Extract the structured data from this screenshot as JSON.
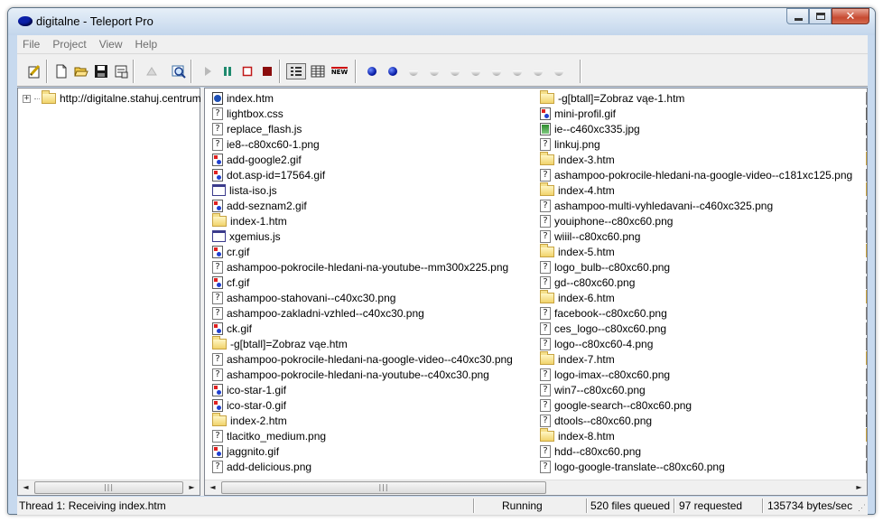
{
  "window": {
    "title": "digitalne - Teleport Pro",
    "close_glyph": "✕"
  },
  "menu": [
    "File",
    "Project",
    "View",
    "Help"
  ],
  "toolbar": {
    "buttons": [
      {
        "name": "project-properties-button",
        "icon": "pencil-note-icon"
      },
      {
        "name": "new-project-button",
        "icon": "new-page-icon"
      },
      {
        "name": "open-project-button",
        "icon": "folder-open-icon"
      },
      {
        "name": "save-project-button",
        "icon": "floppy-disk-icon"
      },
      {
        "name": "project-settings-button",
        "icon": "properties-icon"
      },
      {
        "name": "disabled-tool-button",
        "icon": "disabled-icon"
      },
      {
        "name": "browse-button",
        "icon": "magnifier-icon"
      },
      {
        "name": "start-button",
        "icon": "play-icon"
      },
      {
        "name": "pause-button",
        "icon": "pause-icon"
      },
      {
        "name": "stop-button",
        "icon": "stop-outline-icon"
      },
      {
        "name": "abort-button",
        "icon": "stop-filled-icon"
      },
      {
        "name": "list-view-button",
        "icon": "list-view-icon"
      },
      {
        "name": "details-view-button",
        "icon": "details-view-icon"
      },
      {
        "name": "new-files-button",
        "icon": "new-badge-icon"
      }
    ],
    "new_badge_text": "NEW",
    "thread_lights": [
      "active",
      "active",
      "idle",
      "idle",
      "idle",
      "idle",
      "idle",
      "idle",
      "idle",
      "idle"
    ]
  },
  "tree": {
    "root_label": "http://digitalne.stahuj.centrum",
    "expander": "+"
  },
  "files": {
    "column1": [
      {
        "name": "index.htm",
        "type": "htm"
      },
      {
        "name": "lightbox.css",
        "type": "unknown"
      },
      {
        "name": "replace_flash.js",
        "type": "unknown"
      },
      {
        "name": "ie8--c80xc60-1.png",
        "type": "unknown"
      },
      {
        "name": "add-google2.gif",
        "type": "img"
      },
      {
        "name": "dot.asp-id=17564.gif",
        "type": "img"
      },
      {
        "name": "lista-iso.js",
        "type": "js"
      },
      {
        "name": "add-seznam2.gif",
        "type": "img"
      },
      {
        "name": "index-1.htm",
        "type": "folder"
      },
      {
        "name": "xgemius.js",
        "type": "js"
      },
      {
        "name": "cr.gif",
        "type": "img"
      },
      {
        "name": "ashampoo-pokrocile-hledani-na-youtube--mm300x225.png",
        "type": "unknown"
      },
      {
        "name": "cf.gif",
        "type": "img"
      },
      {
        "name": "ashampoo-stahovani--c40xc30.png",
        "type": "unknown"
      },
      {
        "name": "ashampoo-zakladni-vzhled--c40xc30.png",
        "type": "unknown"
      },
      {
        "name": "ck.gif",
        "type": "img"
      },
      {
        "name": "-g[btall]=Zobraz vąe.htm",
        "type": "folder"
      },
      {
        "name": "ashampoo-pokrocile-hledani-na-google-video--c40xc30.png",
        "type": "unknown"
      },
      {
        "name": "ashampoo-pokrocile-hledani-na-youtube--c40xc30.png",
        "type": "unknown"
      },
      {
        "name": "ico-star-1.gif",
        "type": "img"
      },
      {
        "name": "ico-star-0.gif",
        "type": "img"
      },
      {
        "name": "index-2.htm",
        "type": "folder"
      },
      {
        "name": "tlacitko_medium.png",
        "type": "unknown"
      },
      {
        "name": "jaggnito.gif",
        "type": "img"
      },
      {
        "name": "add-delicious.png",
        "type": "unknown"
      }
    ],
    "column2": [
      {
        "name": "-g[btall]=Zobraz vąe-1.htm",
        "type": "folder"
      },
      {
        "name": "mini-profil.gif",
        "type": "img"
      },
      {
        "name": "ie--c460xc335.jpg",
        "type": "jpg"
      },
      {
        "name": "linkuj.png",
        "type": "unknown"
      },
      {
        "name": "index-3.htm",
        "type": "folder"
      },
      {
        "name": "ashampoo-pokrocile-hledani-na-google-video--c181xc125.png",
        "type": "unknown"
      },
      {
        "name": "index-4.htm",
        "type": "folder"
      },
      {
        "name": "ashampoo-multi-vyhledavani--c460xc325.png",
        "type": "unknown"
      },
      {
        "name": "youiphone--c80xc60.png",
        "type": "unknown"
      },
      {
        "name": "wiiil--c80xc60.png",
        "type": "unknown"
      },
      {
        "name": "index-5.htm",
        "type": "folder"
      },
      {
        "name": "logo_bulb--c80xc60.png",
        "type": "unknown"
      },
      {
        "name": "gd--c80xc60.png",
        "type": "unknown"
      },
      {
        "name": "index-6.htm",
        "type": "folder"
      },
      {
        "name": "facebook--c80xc60.png",
        "type": "unknown"
      },
      {
        "name": "ces_logo--c80xc60.png",
        "type": "unknown"
      },
      {
        "name": "logo--c80xc60-4.png",
        "type": "unknown"
      },
      {
        "name": "index-7.htm",
        "type": "folder"
      },
      {
        "name": "logo-imax--c80xc60.png",
        "type": "unknown"
      },
      {
        "name": "win7--c80xc60.png",
        "type": "unknown"
      },
      {
        "name": "google-search--c80xc60.png",
        "type": "unknown"
      },
      {
        "name": "dtools--c80xc60.png",
        "type": "unknown"
      },
      {
        "name": "index-8.htm",
        "type": "folder"
      },
      {
        "name": "hdd--c80xc60.png",
        "type": "unknown"
      },
      {
        "name": "logo-google-translate--c80xc60.png",
        "type": "unknown"
      }
    ],
    "column3_types": [
      "unknown",
      "img",
      "jpg",
      "unknown",
      "folder",
      "unknown",
      "folder",
      "unknown",
      "unknown",
      "unknown",
      "folder",
      "unknown",
      "unknown",
      "folder",
      "unknown",
      "unknown",
      "unknown",
      "folder",
      "unknown",
      "unknown",
      "unknown",
      "jpg",
      "folder",
      "unknown",
      "unknown"
    ]
  },
  "scrollbar": {
    "left_arrow": "◄",
    "right_arrow": "►",
    "grip": "|||"
  },
  "status": {
    "thread": "Thread 1: Receiving index.htm",
    "state": "Running",
    "queued": "520 files queued",
    "requested": "97 requested",
    "rate": "135734 bytes/sec"
  }
}
